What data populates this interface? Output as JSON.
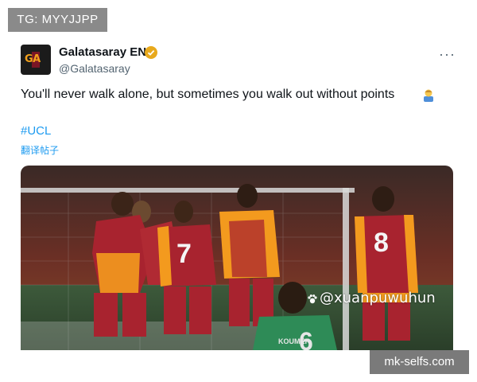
{
  "overlay": {
    "tg_tag": "TG: MYYJJPP",
    "site_tag": "mk-selfs.com",
    "watermark": "@xuanpuwuhun"
  },
  "tweet": {
    "display_name": "Galatasaray EN",
    "handle": "@Galatasaray",
    "text": "You'll never walk alone, but sometimes you walk out without points",
    "hashtag": "#UCL",
    "translate_label": "翻译帖子",
    "more_label": "···",
    "avatar_text": "GA",
    "verified_color": "#e8a91c"
  },
  "photo": {
    "jersey_numbers": [
      "7",
      "8",
      "6"
    ],
    "jersey_name": "KOUMER",
    "team_colors": [
      "#a8232f",
      "#f39a1e",
      "#2e8b57"
    ]
  }
}
